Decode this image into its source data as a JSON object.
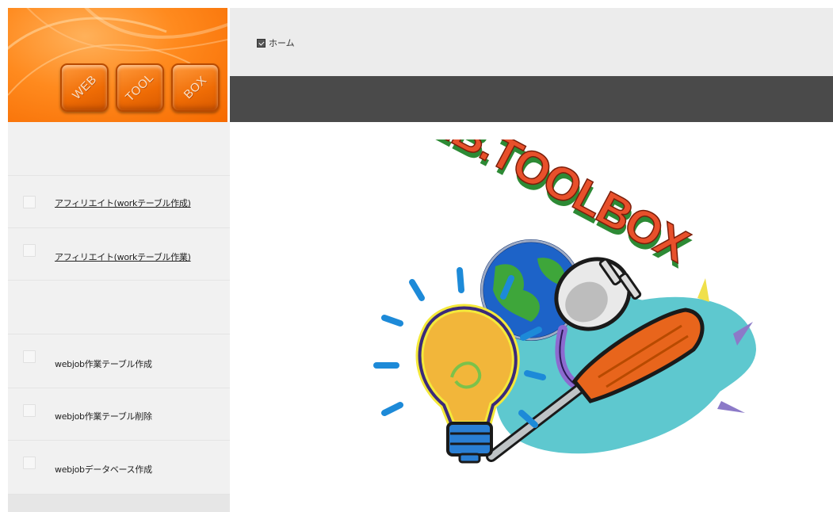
{
  "logo": {
    "tiles": [
      "WEB",
      "TOOL",
      "BOX"
    ]
  },
  "breadcrumb": {
    "home_label": "ホーム",
    "home_icon": "home-icon"
  },
  "sidebar": {
    "items": [
      {
        "label": "アフィリエイト(workテーブル作成)",
        "link": true
      },
      {
        "label": "アフィリエイト(workテーブル作業)",
        "link": true
      },
      {
        "label": "webjob作業テーブル作成",
        "link": false
      },
      {
        "label": "webjob作業テーブル削除",
        "link": false
      },
      {
        "label": "webjobデータベース作成",
        "link": false
      }
    ]
  },
  "clipart": {
    "banner_text": "WEB.TOOLBOX",
    "icons": [
      "globe-icon",
      "light-bulb-icon",
      "plug-icon",
      "screwdriver-icon"
    ]
  },
  "colors": {
    "logo_orange": "#f66a00",
    "dark_band": "#4a4a4a",
    "top_bar": "#ececec",
    "sidebar_bg": "#f1f1f1",
    "banner_red": "#e8502b",
    "banner_green": "#3aa340"
  }
}
